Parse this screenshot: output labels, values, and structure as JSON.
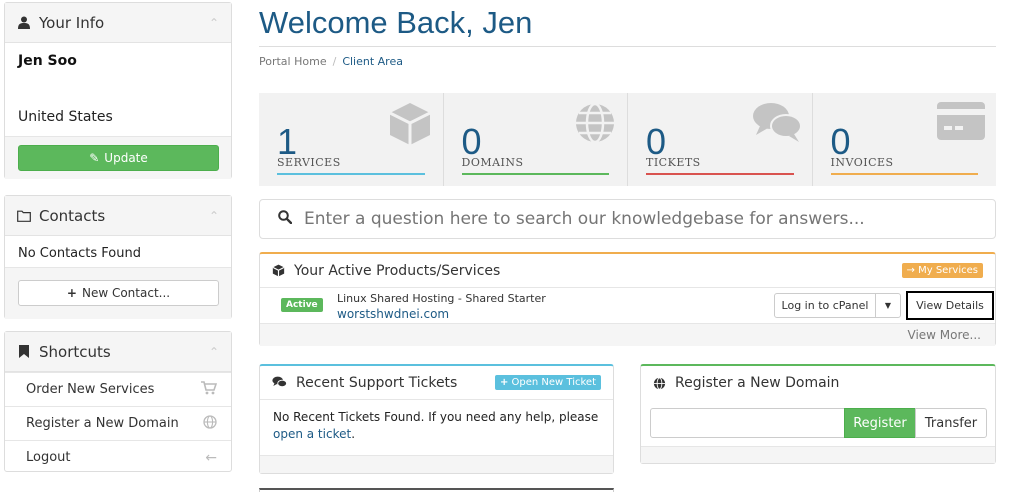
{
  "sidebar": {
    "your_info": {
      "title": "Your Info",
      "name": "Jen Soo",
      "country": "United States",
      "update_label": "Update"
    },
    "contacts": {
      "title": "Contacts",
      "empty_text": "No Contacts Found",
      "new_contact_label": "New Contact..."
    },
    "shortcuts": {
      "title": "Shortcuts",
      "items": [
        {
          "label": "Order New Services",
          "icon": "cart-icon"
        },
        {
          "label": "Register a New Domain",
          "icon": "globe-icon"
        },
        {
          "label": "Logout",
          "icon": "arrow-left-icon"
        }
      ]
    }
  },
  "header": {
    "title": "Welcome Back, Jen",
    "breadcrumb": [
      "Portal Home",
      "Client Area"
    ]
  },
  "stats": [
    {
      "value": "1",
      "label": "SERVICES",
      "color": "#5bc0de",
      "icon": "cube-icon"
    },
    {
      "value": "0",
      "label": "DOMAINS",
      "color": "#5cb85c",
      "icon": "globe-icon"
    },
    {
      "value": "0",
      "label": "TICKETS",
      "color": "#d9534f",
      "icon": "comments-icon"
    },
    {
      "value": "0",
      "label": "INVOICES",
      "color": "#f0ad4e",
      "icon": "credit-card-icon"
    }
  ],
  "search": {
    "placeholder": "Enter a question here to search our knowledgebase for answers..."
  },
  "products": {
    "title": "Your Active Products/Services",
    "my_services_label": "My Services",
    "item": {
      "status": "Active",
      "name": "Linux Shared Hosting - Shared Starter",
      "domain": "worstshwdnei.com",
      "cpanel_label": "Log in to cPanel",
      "view_details_label": "View Details"
    },
    "view_more_label": "View More..."
  },
  "tickets": {
    "title": "Recent Support Tickets",
    "new_ticket_label": "Open New Ticket",
    "empty_text": "No Recent Tickets Found. If you need any help, please",
    "link_text": "open a ticket",
    "link_suffix": "."
  },
  "domain": {
    "title": "Register a New Domain",
    "register_label": "Register",
    "transfer_label": "Transfer"
  }
}
